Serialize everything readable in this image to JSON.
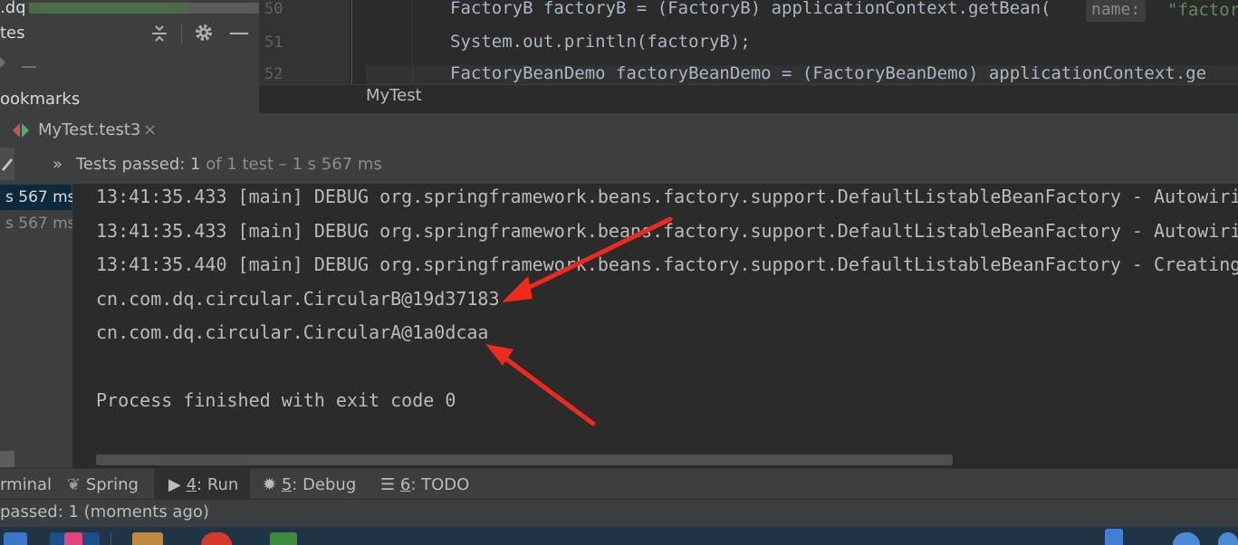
{
  "left_panel": {
    "project_text": ".dq",
    "structure_label": "tes",
    "bookmarks_label": "ookmarks"
  },
  "editor": {
    "line_numbers": [
      "50",
      "51",
      "52"
    ],
    "lines": [
      "FactoryB factoryB = (FactoryB) applicationContext.getBean(",
      "System.out.println(factoryB);",
      "FactoryBeanDemo factoryBeanDemo = (FactoryBeanDemo) applicationContext.ge"
    ],
    "line1_hint": "name:",
    "line1_tail": "\"factor"
  },
  "run_window": {
    "title": "MyTest",
    "tab_label": "MyTest.test3",
    "tab_close": "×",
    "status_chevron": "»",
    "status_passed": "Tests passed: 1",
    "status_detail": " of 1 test – 1 s 567 ms"
  },
  "test_tree": {
    "items": [
      {
        "time": "s 567 ms",
        "selected": true
      },
      {
        "time": "s 567 ms",
        "selected": false
      }
    ]
  },
  "console": {
    "lines": [
      "13:41:35.433 [main] DEBUG org.springframework.beans.factory.support.DefaultListableBeanFactory - Autowiri",
      "13:41:35.433 [main] DEBUG org.springframework.beans.factory.support.DefaultListableBeanFactory - Autowiri",
      "13:41:35.440 [main] DEBUG org.springframework.beans.factory.support.DefaultListableBeanFactory - Creating",
      "cn.com.dq.circular.CircularB@19d37183",
      "cn.com.dq.circular.CircularA@1a0dcaa",
      "",
      "Process finished with exit code 0"
    ]
  },
  "tool_windows": {
    "terminal": "rminal",
    "spring": "Spring",
    "run_num": "4",
    "run_label": ": Run",
    "debug_num": "5",
    "debug_label": ": Debug",
    "todo_num": "6",
    "todo_label": ": TODO"
  },
  "footer": {
    "text": "passed: 1 (moments ago)"
  },
  "colors": {
    "accent_red": "#ee2a1c",
    "panel_bg": "#3c3f41",
    "editor_bg": "#2b2b2b"
  }
}
